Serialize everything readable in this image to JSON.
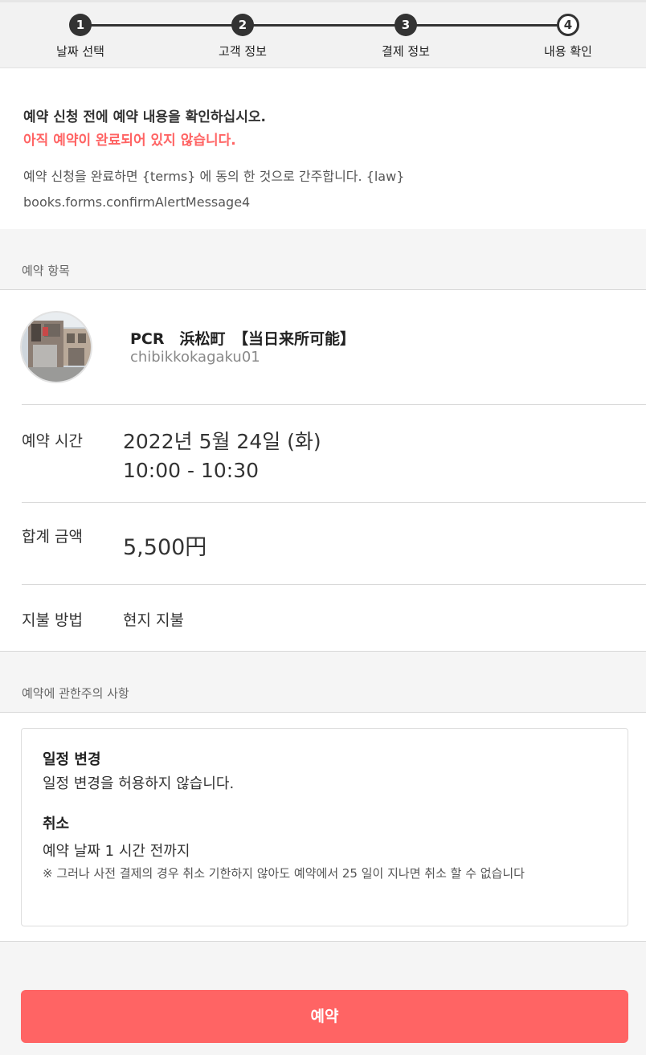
{
  "stepper": {
    "steps": [
      {
        "number": "1",
        "label": "날짜 선택"
      },
      {
        "number": "2",
        "label": "고객 정보"
      },
      {
        "number": "3",
        "label": "결제 정보"
      },
      {
        "number": "4",
        "label": "내용 확인"
      }
    ],
    "current_step": 4
  },
  "alert": {
    "title": "예약 신청 전에 예약 내용을 확인하십시오.",
    "warning": "아직 예약이 완료되어 있지 않습니다.",
    "terms_line": "예약 신청을 완료하면 {terms} 에 동의 한 것으로 간주합니다. {law}",
    "message_key": "books.forms.confirmAlertMessage4"
  },
  "booking_section": {
    "header": "예약 항목",
    "service_name": "PCR　浜松町　【当日来所可能】",
    "service_id": "chibikkokagaku01",
    "time_label": "예약 시간",
    "date": "2022년 5월 24일 (화)",
    "time": "10:00 - 10:30",
    "amount_label": "합계 금액",
    "amount": "5,500円",
    "payment_label": "지불 방법",
    "payment_method": "현지 지불"
  },
  "notes_section": {
    "header": "예약에 관한주의 사항",
    "change_title": "일정 변경",
    "change_text": "일정 변경을 허용하지 않습니다.",
    "cancel_title": "취소",
    "cancel_text": "예약 날짜 1 시간 전까지",
    "cancel_note": "※ 그러나 사전 결제의 경우 취소 기한하지 않아도 예약에서 25 일이 지나면 취소 할 수 없습니다"
  },
  "reserve_button": "예약",
  "colors": {
    "accent": "#ff6464",
    "step_active": "#333333"
  },
  "icons": {
    "avatar": "storefront-photo"
  }
}
